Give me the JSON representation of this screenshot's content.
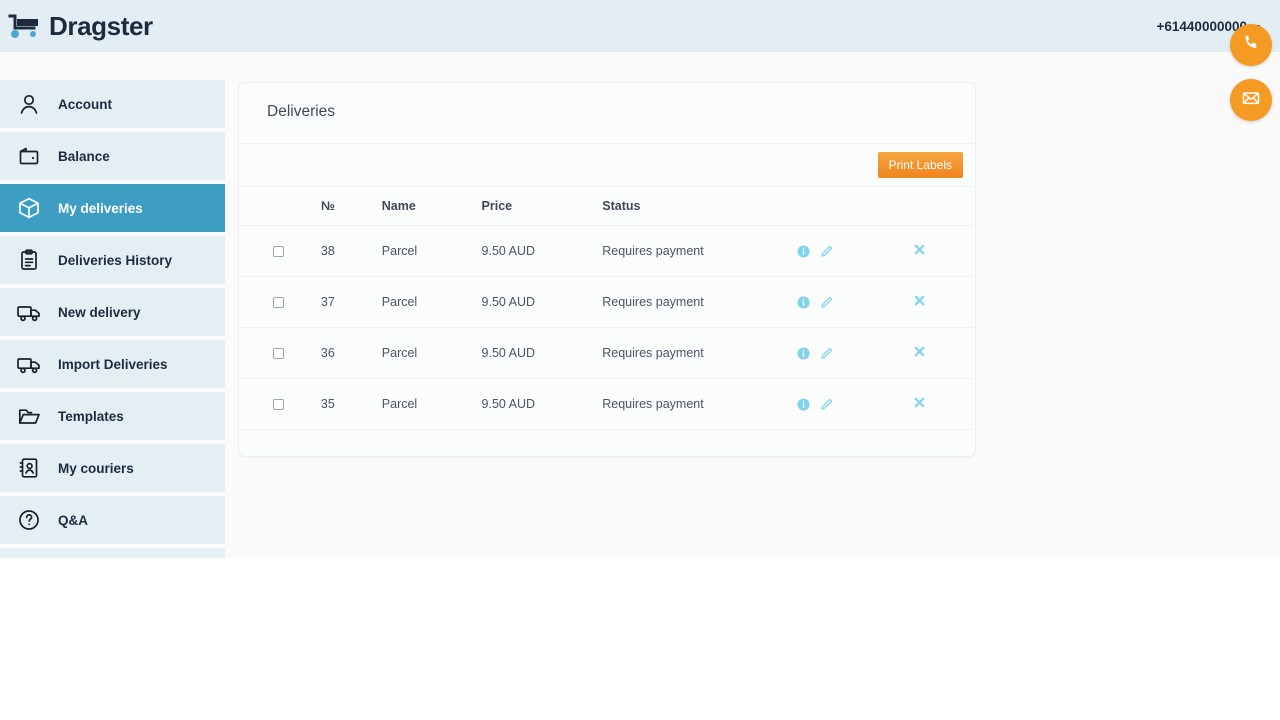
{
  "header": {
    "brand_name": "Dragster",
    "brand_icon": "shopping-cart-icon",
    "phone": "+61440000000"
  },
  "sidebar": {
    "items": [
      {
        "label": "Account",
        "icon": "user-icon",
        "active": false
      },
      {
        "label": "Balance",
        "icon": "wallet-icon",
        "active": false
      },
      {
        "label": "My deliveries",
        "icon": "box-icon",
        "active": true
      },
      {
        "label": "Deliveries History",
        "icon": "clipboard-icon",
        "active": false
      },
      {
        "label": "New delivery",
        "icon": "truck-icon",
        "active": false
      },
      {
        "label": "Import Deliveries",
        "icon": "truck-icon",
        "active": false
      },
      {
        "label": "Templates",
        "icon": "folder-icon",
        "active": false
      },
      {
        "label": "My couriers",
        "icon": "contacts-icon",
        "active": false
      },
      {
        "label": "Q&A",
        "icon": "question-icon",
        "active": false
      }
    ]
  },
  "main": {
    "card_title": "Deliveries",
    "print_labels_label": "Print Labels",
    "table": {
      "columns": [
        "",
        "№",
        "Name",
        "Price",
        "Status",
        "",
        ""
      ],
      "rows": [
        {
          "checked": false,
          "number": "38",
          "name": "Parcel",
          "price": "9.50 AUD",
          "status": "Requires payment"
        },
        {
          "checked": false,
          "number": "37",
          "name": "Parcel",
          "price": "9.50 AUD",
          "status": "Requires payment"
        },
        {
          "checked": false,
          "number": "36",
          "name": "Parcel",
          "price": "9.50 AUD",
          "status": "Requires payment"
        },
        {
          "checked": false,
          "number": "35",
          "name": "Parcel",
          "price": "9.50 AUD",
          "status": "Requires payment"
        }
      ],
      "row_actions": [
        "info-icon",
        "edit-pencil-icon",
        "delete-x-icon"
      ]
    }
  },
  "floating_actions": [
    {
      "icon": "phone-icon",
      "name": "call-button"
    },
    {
      "icon": "envelope-icon",
      "name": "email-button"
    }
  ],
  "colors": {
    "header_bg": "#e3eef4",
    "sidebar_item_bg": "#e4eff4",
    "sidebar_active_bg": "#3d9dc3",
    "accent_orange": "#f59a23",
    "action_cyan": "#7fd4ec",
    "page_bg": "#fafafb"
  }
}
